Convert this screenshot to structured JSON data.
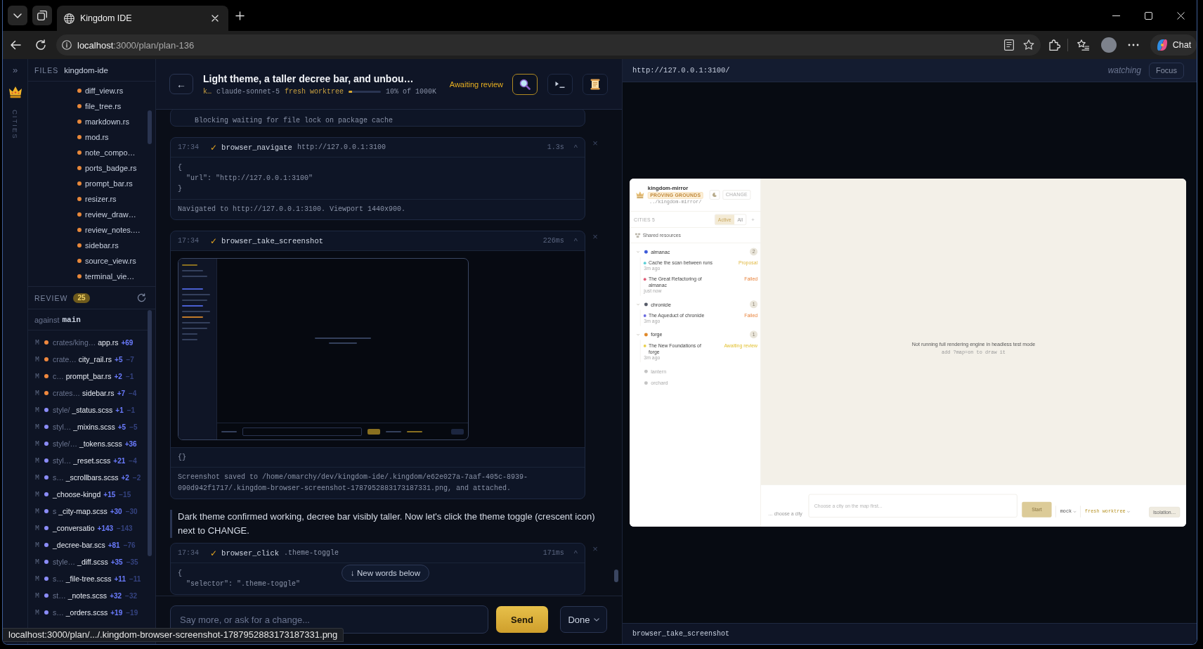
{
  "browser": {
    "tabs": [
      {
        "title": "Kingdom IDE",
        "selected": true
      }
    ],
    "url": {
      "host": "localhost",
      "rest": ":3000/plan/plan-136"
    },
    "chat": "Chat"
  },
  "rail": {
    "expand": "»",
    "section": "CITIES"
  },
  "files": {
    "label": "FILES",
    "root": "kingdom-ide",
    "items": [
      "diff_view.rs",
      "file_tree.rs",
      "markdown.rs",
      "mod.rs",
      "note_compo…",
      "ports_badge.rs",
      "prompt_bar.rs",
      "resizer.rs",
      "review_draw…",
      "review_notes.…",
      "sidebar.rs",
      "source_view.rs",
      "terminal_vie…"
    ]
  },
  "review": {
    "label": "REVIEW",
    "count": "25",
    "against": "against",
    "branch": "main",
    "files": [
      {
        "status": "M",
        "color": "#f0883e",
        "dir": "crates/king…",
        "name": "app.rs",
        "added": "+69"
      },
      {
        "status": "M",
        "color": "#f0883e",
        "dir": "crate…",
        "name": "city_rail.rs",
        "added": "+5",
        "removed": "−7"
      },
      {
        "status": "M",
        "color": "#f0883e",
        "dir": "c…",
        "name": "prompt_bar.rs",
        "added": "+2",
        "removed": "−1"
      },
      {
        "status": "M",
        "color": "#f0883e",
        "dir": "crates…",
        "name": "sidebar.rs",
        "added": "+7",
        "removed": "−4"
      },
      {
        "status": "M",
        "color": "#8b8cf8",
        "dir": "style/",
        "name": "_status.scss",
        "added": "+1",
        "removed": "−1"
      },
      {
        "status": "M",
        "color": "#8b8cf8",
        "dir": "styl…",
        "name": "_mixins.scss",
        "added": "+5",
        "removed": "−5"
      },
      {
        "status": "M",
        "color": "#8b8cf8",
        "dir": "style/…",
        "name": "_tokens.scss",
        "added": "+36"
      },
      {
        "status": "M",
        "color": "#8b8cf8",
        "dir": "styl…",
        "name": "_reset.scss",
        "added": "+21",
        "removed": "−4"
      },
      {
        "status": "M",
        "color": "#8b8cf8",
        "dir": "s…",
        "name": "_scrollbars.scss",
        "added": "+2",
        "removed": "−2"
      },
      {
        "status": "M",
        "color": "#8b8cf8",
        "name": "_choose-kingd",
        "added": "+15",
        "removed": "−15"
      },
      {
        "status": "M",
        "color": "#8b8cf8",
        "dir": "s",
        "name": "_city-map.scss",
        "added": "+30",
        "removed": "−30"
      },
      {
        "status": "M",
        "color": "#8b8cf8",
        "name": "_conversatio",
        "added": "+143",
        "removed": "−143"
      },
      {
        "status": "M",
        "color": "#8b8cf8",
        "name": "_decree-bar.scs",
        "added": "+81",
        "removed": "−76"
      },
      {
        "status": "M",
        "color": "#8b8cf8",
        "dir": "style…",
        "name": "_diff.scss",
        "added": "+35",
        "removed": "−35"
      },
      {
        "status": "M",
        "color": "#8b8cf8",
        "dir": "s…",
        "name": "_file-tree.scss",
        "added": "+11",
        "removed": "−11"
      },
      {
        "status": "M",
        "color": "#8b8cf8",
        "dir": "st…",
        "name": "_notes.scss",
        "added": "+32",
        "removed": "−32"
      },
      {
        "status": "M",
        "color": "#8b8cf8",
        "dir": "s…",
        "name": "_orders.scss",
        "added": "+19",
        "removed": "−19"
      }
    ]
  },
  "plan": {
    "back": "←",
    "title": "Light theme, a taller decree bar, and unbou…",
    "kingdom": "k…",
    "model": "claude-sonnet-5",
    "worktree": "fresh worktree",
    "context": {
      "level": 0.1,
      "reading": "10% of 1000K"
    },
    "status": "Awaiting review",
    "tools": [
      {
        "kind": "search",
        "selected": true
      },
      {
        "kind": "terminal",
        "selected": false
      },
      {
        "kind": "scroll",
        "selected": false
      }
    ]
  },
  "chat": {
    "messages": [
      {
        "kind": "output",
        "lines": [
          "    Blocking waiting for file lock on package cache"
        ]
      },
      {
        "kind": "tool",
        "time": "17:34",
        "mark": "✓",
        "name": "browser_navigate",
        "arg": "http://127.0.0.1:3100",
        "duration": "1.3s",
        "toggle": "^",
        "dismiss": "×",
        "screenshot": false,
        "input": [
          "{",
          "  \"url\": \"http://127.0.0.1:3100\"",
          "}"
        ],
        "result": "Navigated to http://127.0.0.1:3100. Viewport 1440x900."
      },
      {
        "kind": "tool",
        "time": "17:34",
        "mark": "✓",
        "name": "browser_take_screenshot",
        "duration": "226ms",
        "toggle": "^",
        "dismiss": "×",
        "screenshot": true,
        "input": [
          "{}"
        ],
        "result": "Screenshot saved to /home/omarchy/dev/kingdom-ide/.kingdom/e62e027a-7aaf-405c-8939-090d942f1717/.kingdom-browser-screenshot-1787952883173187331.png, and attached."
      },
      {
        "kind": "text",
        "text": "Dark theme confirmed working, decree bar visibly taller. Now let's click the theme toggle (crescent icon) next to CHANGE."
      },
      {
        "kind": "tool",
        "time": "17:34",
        "mark": "✓",
        "name": "browser_click",
        "arg": ".theme-toggle",
        "duration": "171ms",
        "toggle": "^",
        "dismiss": "×",
        "screenshot": false,
        "input": [
          "{",
          "  \"selector\": \".theme-toggle\""
        ]
      }
    ],
    "new_words": "↓ New words below",
    "composer": {
      "placeholder": "Say more, or ask for a change...",
      "send": "Send",
      "done": "Done"
    }
  },
  "preview": {
    "url": "http://127.0.0.1:3100/",
    "state": "watching",
    "focus": "Focus",
    "footer": "browser_take_screenshot",
    "page": {
      "kingdom": "kingdom-mirror",
      "badge": "PROVING GROUNDS",
      "path": "../kingdom-mirror/",
      "change": "CHANGE",
      "cities_label": "CITIES 5",
      "filters": [
        {
          "label": "Active",
          "selected": true
        },
        {
          "label": "All",
          "selected": false
        }
      ],
      "add": "+",
      "shared": "Shared resources",
      "cities": [
        {
          "name": "almanac",
          "color": "#3d5bd9",
          "count": "2",
          "active": true,
          "expanded": true,
          "plans": [
            {
              "title": "Cache the scan between runs",
              "color": "#5ccfd6",
              "kind": "proposal",
              "status": "Proposal",
              "age": "3m ago"
            },
            {
              "title": "The Great Refactoring of almanac",
              "color": "#e0607a",
              "kind": "failed",
              "status": "Failed",
              "age": "just now"
            }
          ]
        },
        {
          "name": "chronicle",
          "color": "#565b68",
          "count": "1",
          "active": true,
          "expanded": true,
          "plans": [
            {
              "title": "The Aqueduct of chronicle",
              "color": "#6a6ae0",
              "kind": "failed",
              "status": "Failed",
              "age": "3m ago"
            }
          ]
        },
        {
          "name": "forge",
          "color": "#e0892a",
          "count": "1",
          "active": true,
          "expanded": true,
          "plans": [
            {
              "title": "The New Foundations of forge",
              "color": "#ead04a",
              "kind": "awaiting",
              "status": "Awaiting review",
              "age": "3m ago"
            }
          ]
        },
        {
          "name": "lantern",
          "color": "#c4c4c4",
          "active": false,
          "expanded": false
        },
        {
          "name": "orchard",
          "color": "#c4c4c4",
          "active": false,
          "expanded": false
        }
      ],
      "map_message": "Not running full rendering engine in headless test mode",
      "map_hint": "add ?map=on to draw it",
      "composer": {
        "city_hint": "… choose a city",
        "placeholder": "Choose a city on the map first...",
        "start": "Start",
        "runner": "mock",
        "worktree": "fresh worktree",
        "isolation": "Isolation…"
      }
    }
  },
  "status_link": "localhost:3000/plan/.../.kingdom-browser-screenshot-1787952883173187331.png"
}
